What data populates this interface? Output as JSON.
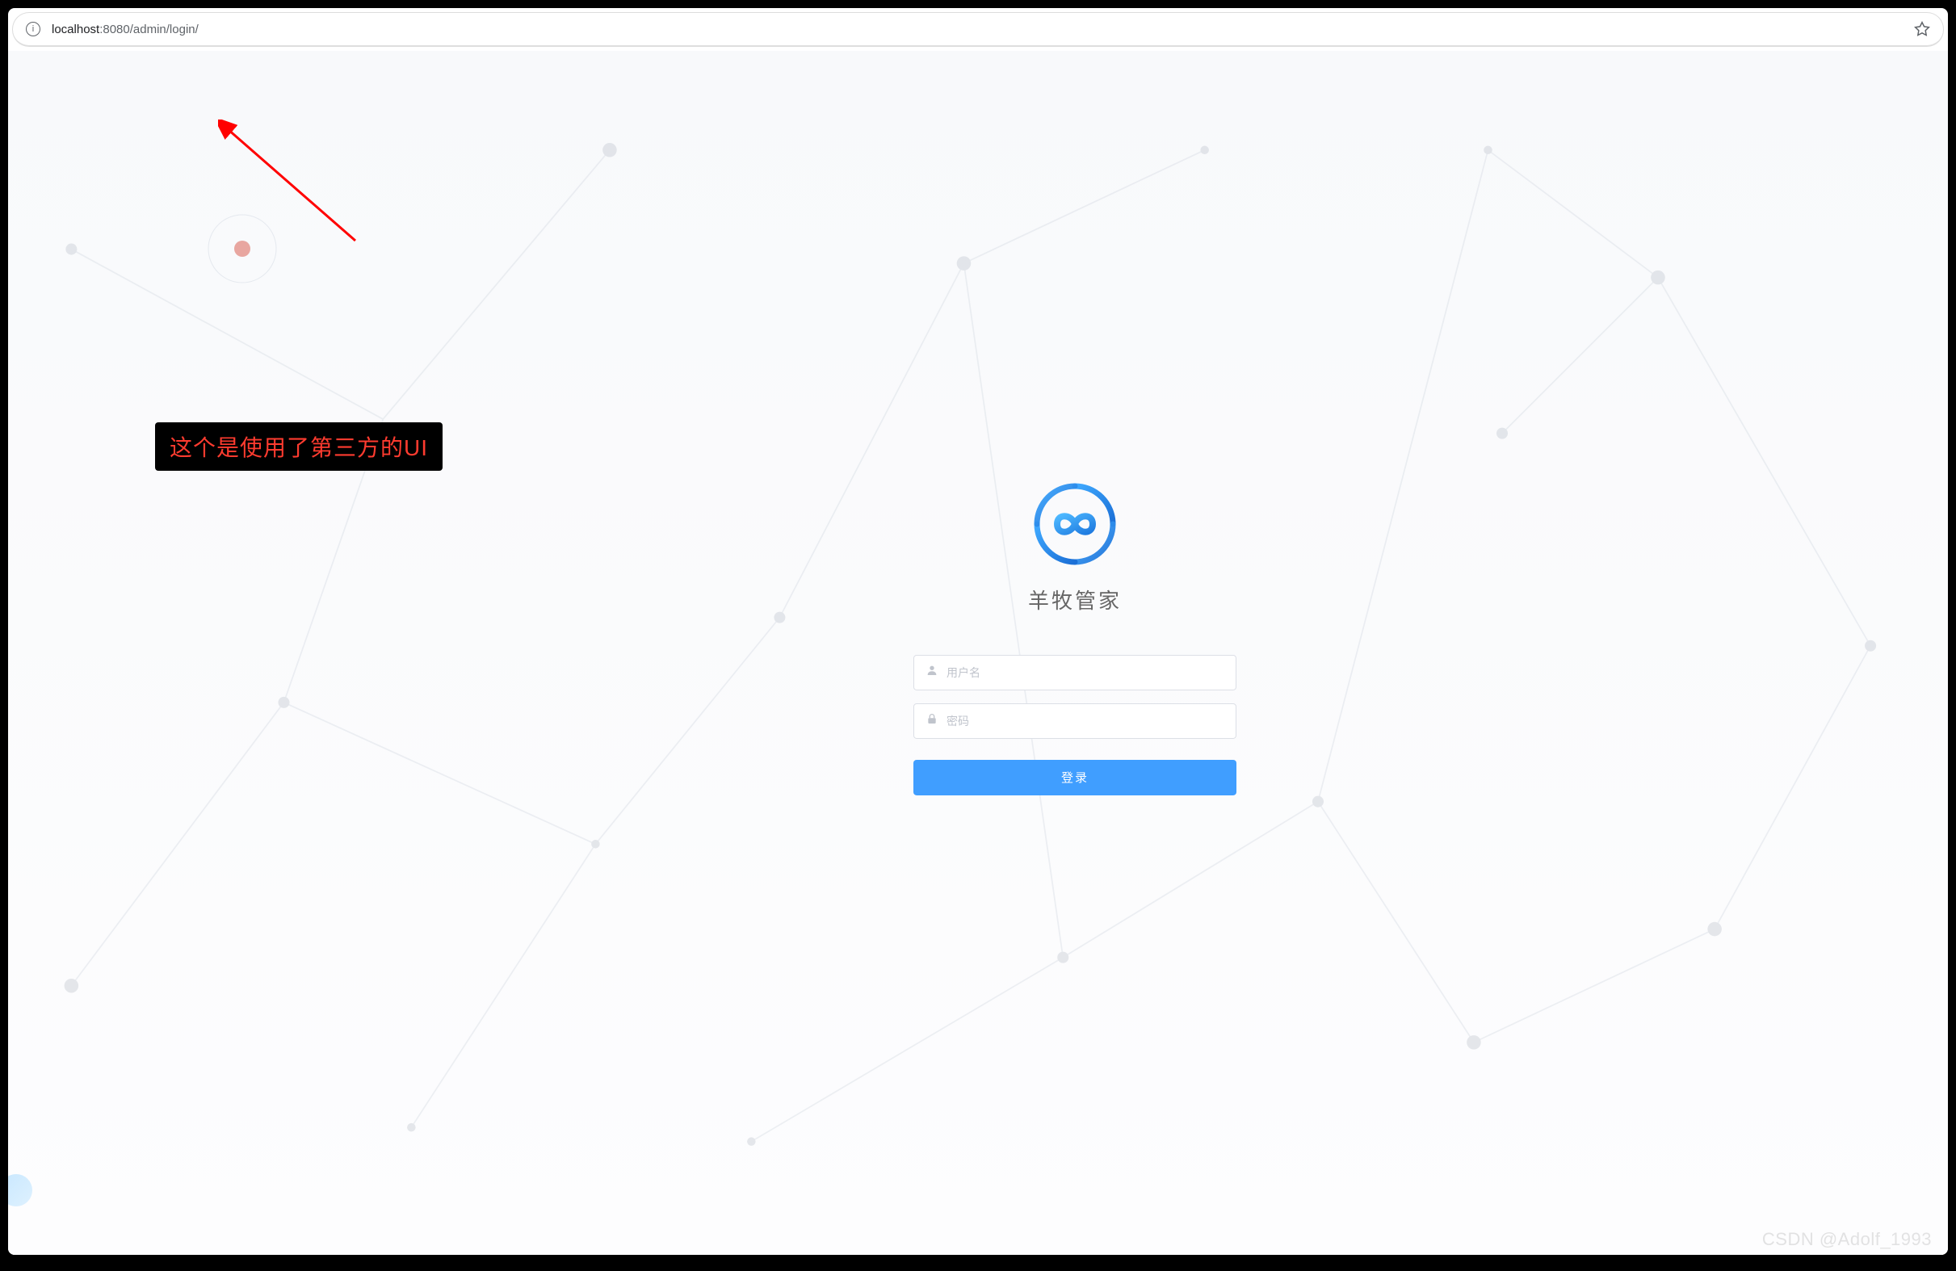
{
  "address_bar": {
    "url_host": "localhost",
    "url_port_path": ":8080/admin/login/"
  },
  "annotation": {
    "text": "这个是使用了第三方的UI"
  },
  "login": {
    "brand_title": "羊牧管家",
    "username_placeholder": "用户名",
    "password_placeholder": "密码",
    "login_button_label": "登录"
  },
  "watermark": {
    "text": "CSDN @Adolf_1993"
  }
}
